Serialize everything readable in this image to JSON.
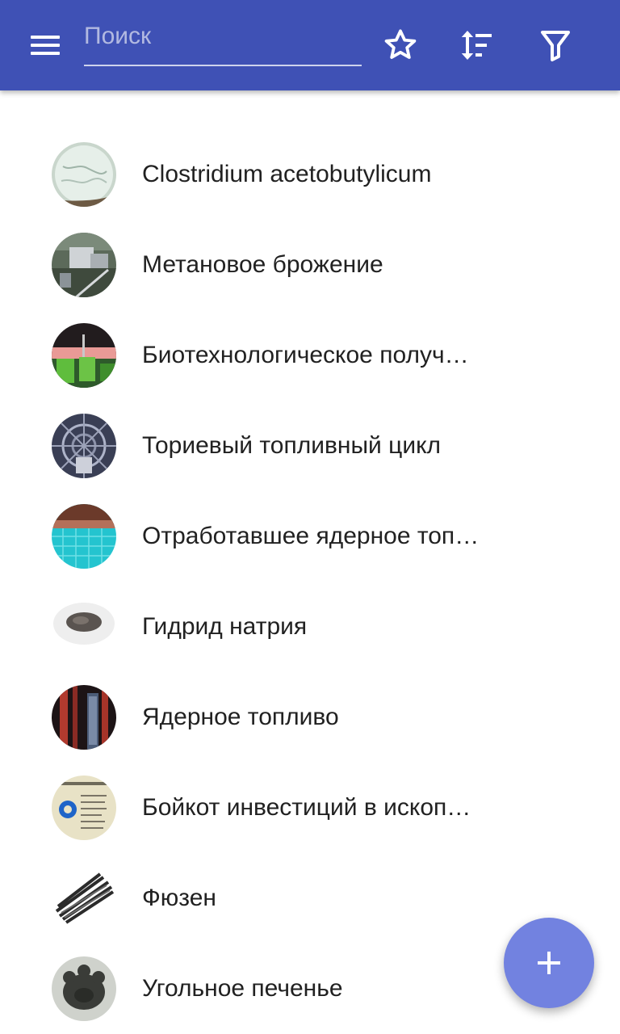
{
  "search": {
    "placeholder": "Поиск",
    "value": ""
  },
  "toolbar": {
    "menu_icon": "hamburger-icon",
    "favorite_icon": "star-icon",
    "sort_icon": "sort-icon",
    "filter_icon": "filter-icon"
  },
  "colors": {
    "appbar": "#3f51b5",
    "fab": "#7282e0",
    "text": "#212121"
  },
  "items": [
    {
      "label": "Clostridium acetobutylicum",
      "icon": "microscope-photo"
    },
    {
      "label": "Метановое брожение",
      "icon": "biogas-plant-photo"
    },
    {
      "label": "Биотехнологическое получение",
      "icon": "lab-photo"
    },
    {
      "label": "Ториевый топливный цикл",
      "icon": "reactor-photo"
    },
    {
      "label": "Отработавшее ядерное топливо",
      "icon": "cooling-pool-photo"
    },
    {
      "label": "Гидрид натрия",
      "icon": "powder-dish-photo"
    },
    {
      "label": "Ядерное топливо",
      "icon": "fuel-rods-photo"
    },
    {
      "label": "Бойкот инвестиций в ископаемое топливо",
      "icon": "chart-photo"
    },
    {
      "label": "Фюзен",
      "icon": "charcoal-sticks-photo"
    },
    {
      "label": "Угольное печенье",
      "icon": "charcoal-biscuit-photo"
    }
  ],
  "fab": {
    "icon": "plus-icon"
  }
}
